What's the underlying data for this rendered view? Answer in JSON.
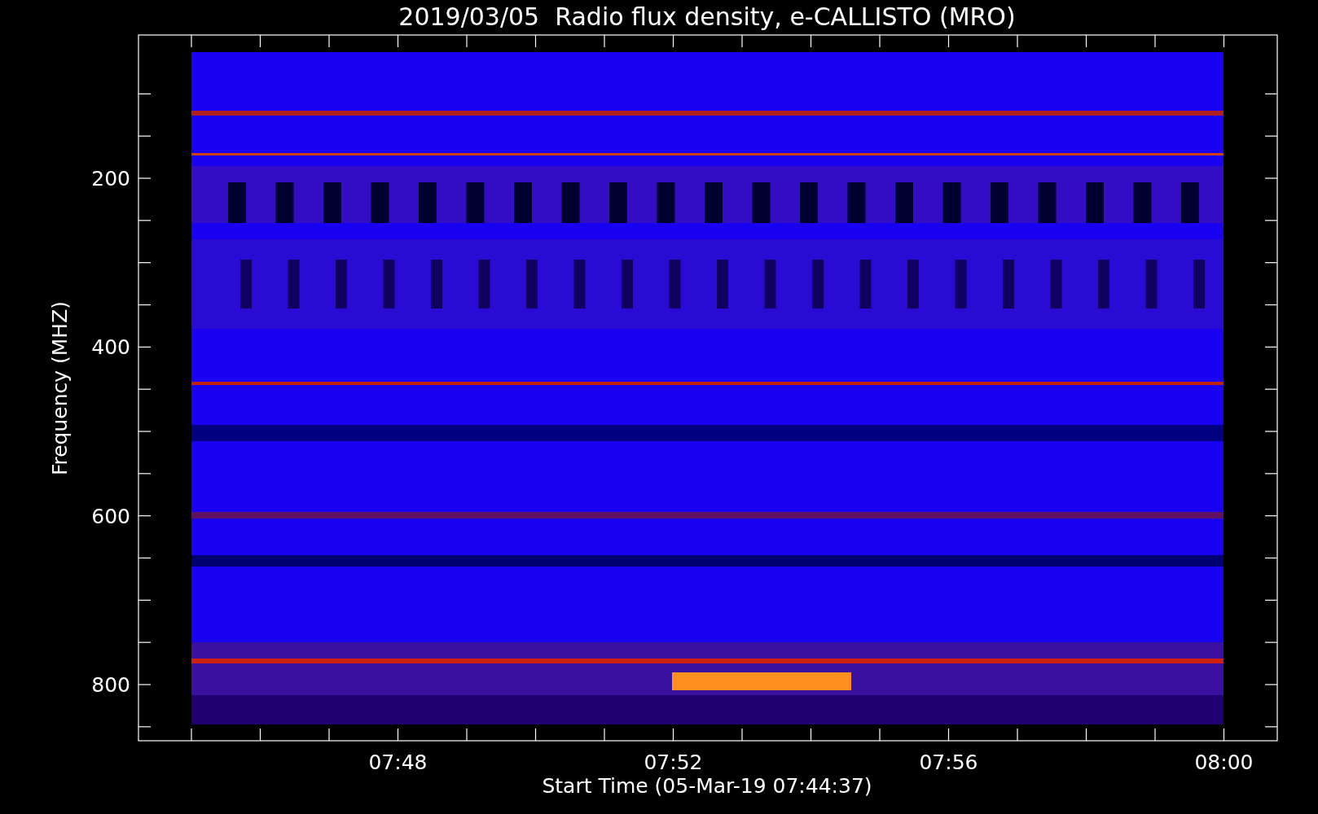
{
  "title": "2019/03/05  Radio flux density, e-CALLISTO (MRO)",
  "y_axis": {
    "label": "Frequency (MHZ)",
    "ticks": [
      "200",
      "400",
      "600",
      "800"
    ]
  },
  "x_axis": {
    "label": "Start Time (05-Mar-19 07:44:37)",
    "ticks": [
      "07:48",
      "07:52",
      "07:56",
      "08:00"
    ]
  }
}
